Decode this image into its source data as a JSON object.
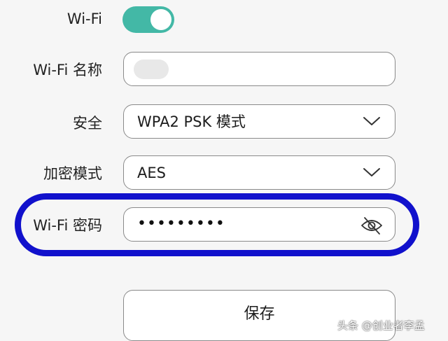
{
  "wifi": {
    "label": "Wi-Fi",
    "enabled": true,
    "accent_color": "#43b8a6"
  },
  "name_field": {
    "label": "Wi-Fi 名称",
    "value": ""
  },
  "security": {
    "label": "安全",
    "selected": "WPA2 PSK 模式",
    "dropdown_icon": "chevron-down-icon"
  },
  "encryption": {
    "label": "加密模式",
    "selected": "AES",
    "dropdown_icon": "chevron-down-icon"
  },
  "password": {
    "label": "Wi-Fi 密码",
    "masked_value": "•••••••••",
    "visibility_icon": "eye-off-icon",
    "highlight_color": "#1111cc"
  },
  "actions": {
    "save_label": "保存"
  },
  "watermark": {
    "text": "头条 @创业者李孟"
  }
}
